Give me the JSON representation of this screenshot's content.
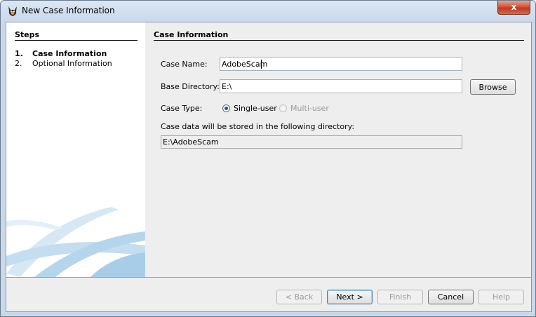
{
  "window": {
    "title": "New Case Information",
    "close_label": "x"
  },
  "steps": {
    "title": "Steps",
    "items": [
      {
        "num": "1.",
        "label": "Case Information",
        "active": true
      },
      {
        "num": "2.",
        "label": "Optional Information",
        "active": false
      }
    ]
  },
  "panel": {
    "title": "Case Information",
    "case_name_label": "Case Name:",
    "case_name_value": "AdobeScam",
    "base_dir_label": "Base Directory:",
    "base_dir_value": "E:\\",
    "browse_label": "Browse",
    "case_type_label": "Case Type:",
    "single_user_label": "Single-user",
    "multi_user_label": "Multi-user",
    "case_type_selected": "Single-user",
    "storage_note": "Case data will be stored in the following directory:",
    "storage_path": "E:\\AdobeScam"
  },
  "buttons": {
    "back": "< Back",
    "next": "Next >",
    "finish": "Finish",
    "cancel": "Cancel",
    "help": "Help"
  }
}
